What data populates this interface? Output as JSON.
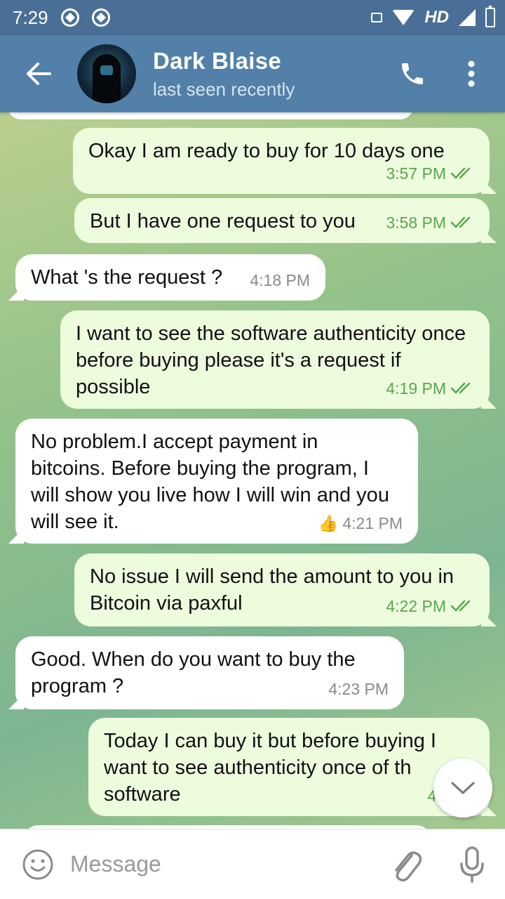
{
  "status_bar": {
    "time": "7:29",
    "network": "HD"
  },
  "header": {
    "contact_name": "Dark Blaise",
    "status": "last seen recently"
  },
  "messages": [
    {
      "direction": "out",
      "text": "Okay I am ready to buy for 10 days one",
      "time": "3:57 PM",
      "read": true
    },
    {
      "direction": "out",
      "text": "But I have one request to you",
      "time": "3:58 PM",
      "read": true
    },
    {
      "direction": "in",
      "text": "What 's the request ?",
      "time": "4:18 PM"
    },
    {
      "direction": "out",
      "text": "I want to see the software authenticity once before buying please it's a request if possible",
      "time": "4:19 PM",
      "read": true
    },
    {
      "direction": "in",
      "text": "No problem.I accept payment in bitcoins. Before buying the program, I will show you live how I will win and you will see it.",
      "time": "4:21 PM",
      "reaction": "👍"
    },
    {
      "direction": "out",
      "text": "No issue I will send the amount to you in Bitcoin via paxful",
      "time": "4:22 PM",
      "read": true
    },
    {
      "direction": "in",
      "text": "Good. When do you want to buy the program ?",
      "time": "4:23 PM"
    },
    {
      "direction": "out",
      "text": "Today I can buy it but before buying I want to see authenticity once of th software",
      "time": "4:23 P",
      "read": true
    }
  ],
  "input": {
    "placeholder": "Message"
  },
  "colors": {
    "header": "#5280a8",
    "status_bar": "#4a6f96",
    "outgoing_bubble": "#eefcde",
    "incoming_bubble": "#ffffff",
    "outgoing_meta": "#5aa54f"
  }
}
